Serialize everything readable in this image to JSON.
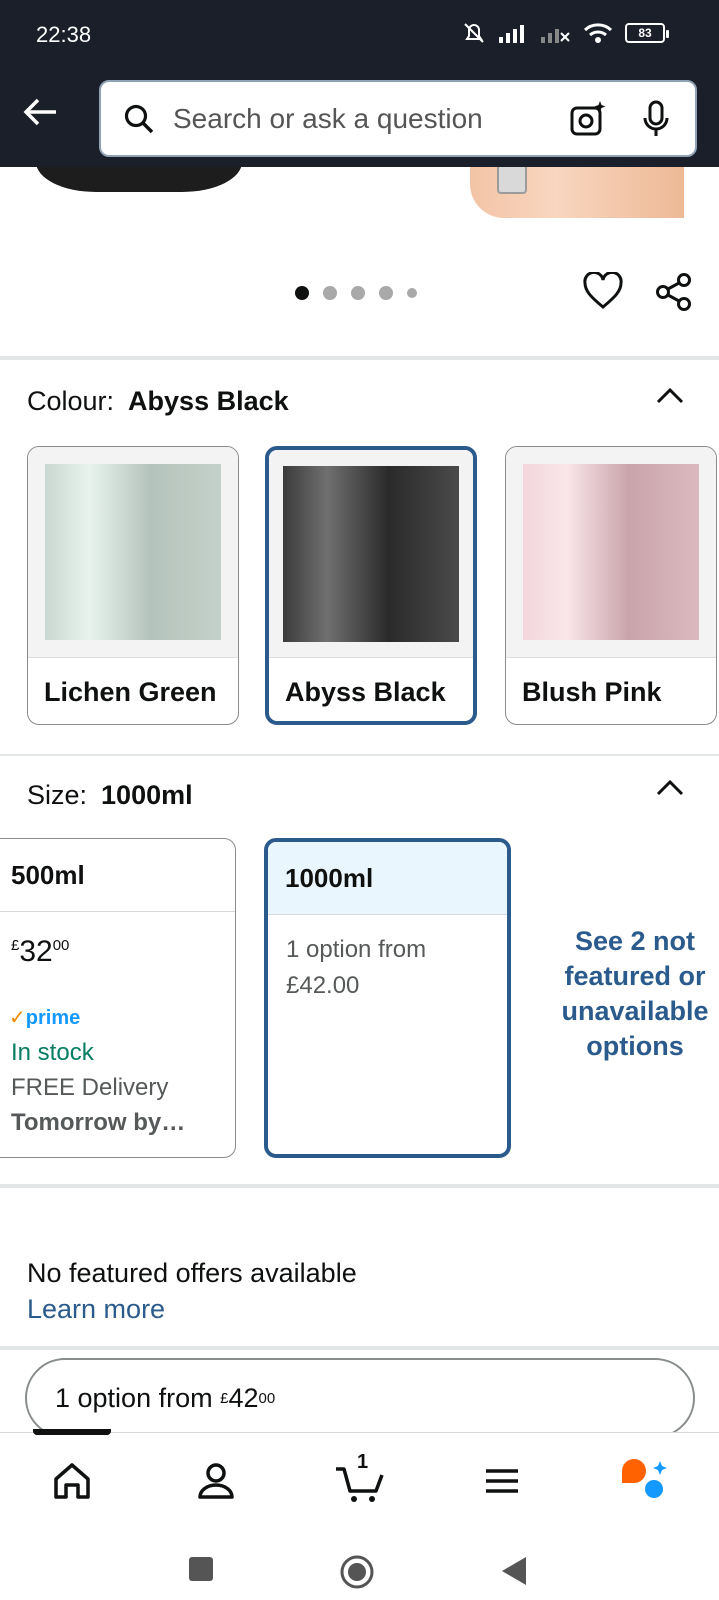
{
  "status_bar": {
    "time": "22:38",
    "battery": "83"
  },
  "header": {
    "search_placeholder": "Search or ask a question"
  },
  "carousel": {
    "dot_count": 5,
    "active_index": 0
  },
  "colour": {
    "label": "Colour:",
    "selected": "Abyss Black",
    "options": [
      {
        "name": "Lichen Green",
        "color_light": "#e3efe9",
        "color_dark": "#a9b8b0"
      },
      {
        "name": "Abyss Black",
        "color_light": "#6e6e6e",
        "color_dark": "#242424"
      },
      {
        "name": "Blush Pink",
        "color_light": "#f7dbe2",
        "color_dark": "#bf9aa2"
      }
    ]
  },
  "size": {
    "label": "Size:",
    "selected": "1000ml",
    "options": [
      {
        "name": "500ml",
        "price_symbol": "£",
        "price_whole": "32",
        "price_fraction": "00",
        "prime_tick": "✓",
        "prime": "prime",
        "stock": "In stock",
        "delivery": "FREE Delivery",
        "delivery_time": "Tomorrow by…"
      },
      {
        "name": "1000ml",
        "offer_line1": "1 option from",
        "offer_line2": "£42.00"
      }
    ],
    "see_more": "See 2 not featured or unavailable options"
  },
  "offers": {
    "no_offers": "No featured offers available",
    "learn_more": "Learn more"
  },
  "option_pill": {
    "text": "1 option from",
    "price_symbol": "£",
    "price_whole": "42",
    "price_fraction": "00"
  },
  "bottom_nav": {
    "cart_count": "1"
  },
  "colors": {
    "accent": "#2b5b8c",
    "header_bg": "#1b1f2a",
    "stock_green": "#067d62",
    "prime_blue": "#1399ff"
  }
}
